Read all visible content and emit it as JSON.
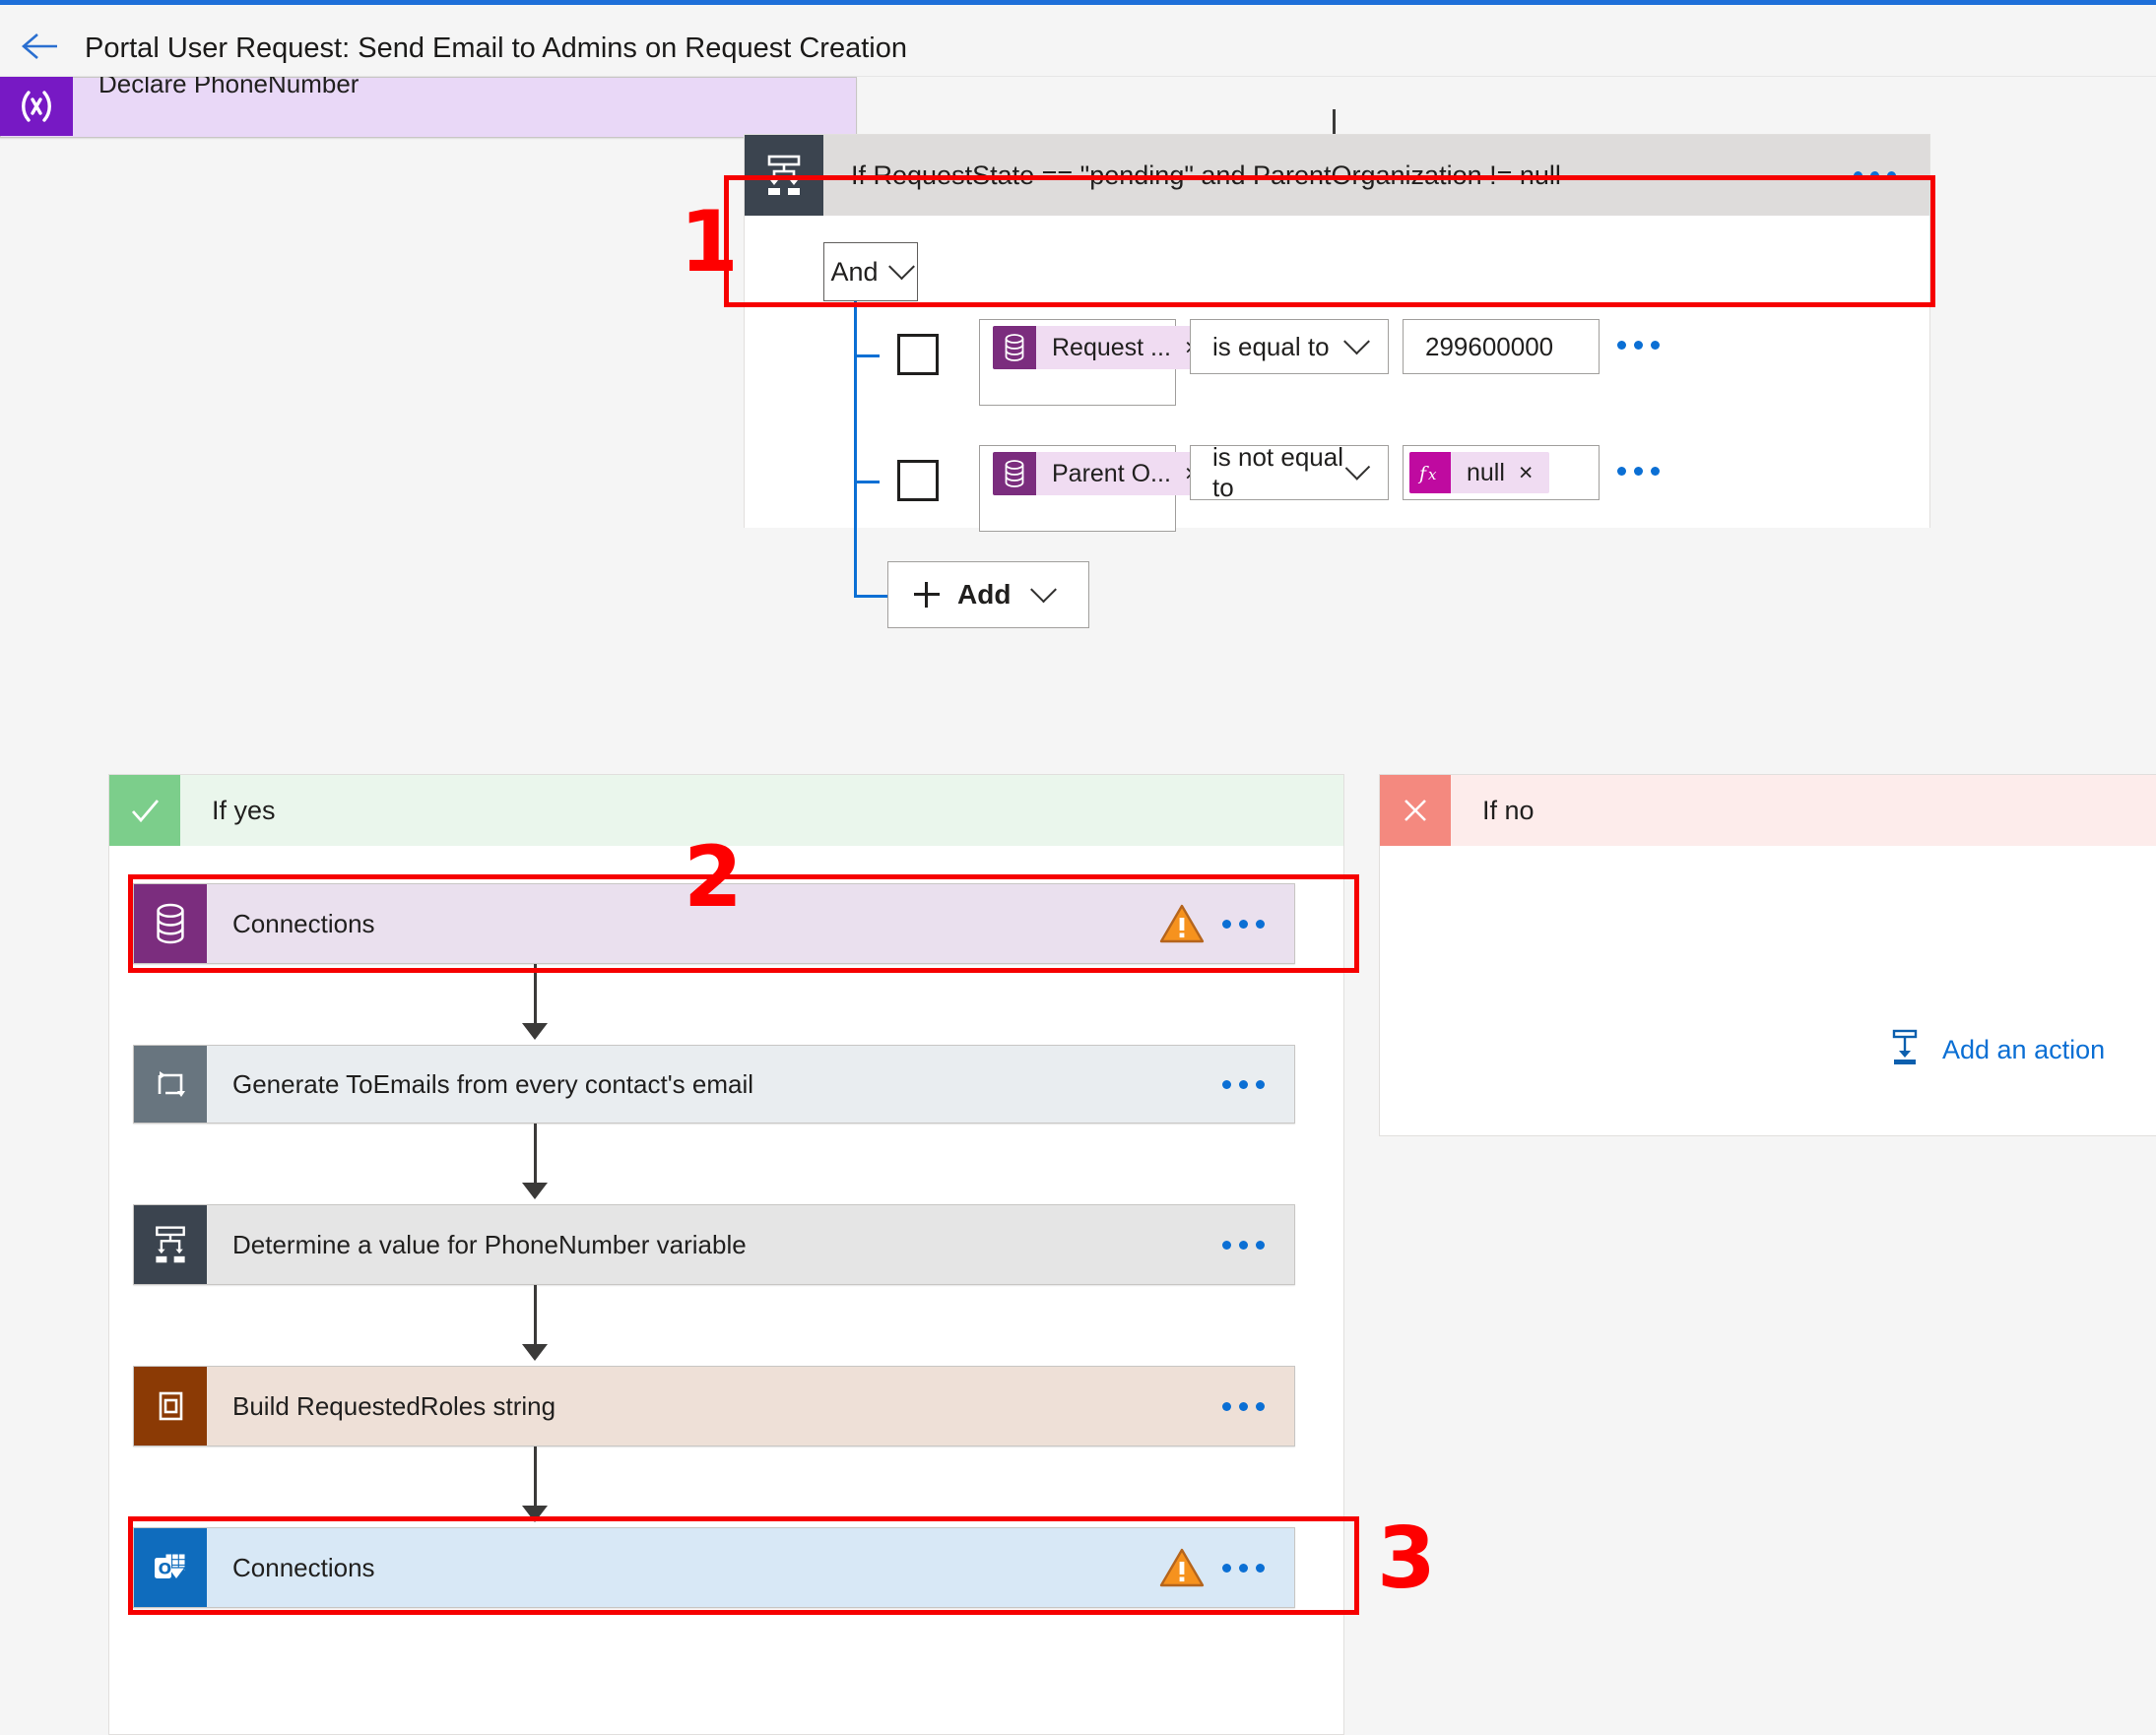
{
  "header": {
    "back_icon": "back-arrow-icon",
    "title": "Portal User Request: Send Email to Admins on Request Creation"
  },
  "flow": {
    "preceding_action": {
      "label": "Declare PhoneNumber",
      "icon": "variables-icon",
      "icon_color": "#7719c4",
      "body_color": "#e9d8f7"
    },
    "condition": {
      "title": "If RequestState == \"pending\" and ParentOrganization != null",
      "icon": "condition-icon",
      "icon_color": "#3b444f",
      "header_color": "#dedcdb",
      "more_label": "•••",
      "operator": "And",
      "rows": [
        {
          "token_label": "Request ...",
          "token_icon": "dataverse-icon",
          "token_remove": "×",
          "operator": "is equal to",
          "value_type": "text",
          "value": "299600000",
          "more_label": "•••"
        },
        {
          "token_label": "Parent O...",
          "token_icon": "dataverse-icon",
          "token_remove": "×",
          "operator": "is not equal to",
          "value_type": "expression",
          "value_icon": "fx-icon",
          "value": "null",
          "value_remove": "×",
          "more_label": "•••"
        }
      ],
      "add_label": "Add"
    },
    "yes_branch": {
      "label": "If yes",
      "icon": "checkmark-icon",
      "icon_color": "#7cce8b",
      "header_color": "#eaf6ec",
      "actions": [
        {
          "label": "Connections",
          "icon": "dataverse-icon",
          "icon_color": "#7b2d7e",
          "body_color": "#eae0ee",
          "warning": true,
          "warning_icon": "warning-icon",
          "more_label": "•••"
        },
        {
          "label": "Generate ToEmails from every contact's email",
          "icon": "apply-to-each-icon",
          "icon_color": "#68757f",
          "body_color": "#e9edf0",
          "warning": false,
          "more_label": "•••"
        },
        {
          "label": "Determine a value for PhoneNumber variable",
          "icon": "condition-icon",
          "icon_color": "#3b444f",
          "body_color": "#e5e5e5",
          "warning": false,
          "more_label": "•••"
        },
        {
          "label": "Build RequestedRoles string",
          "icon": "compose-icon",
          "icon_color": "#8b3a05",
          "body_color": "#eee0d7",
          "warning": false,
          "more_label": "•••"
        },
        {
          "label": "Connections",
          "icon": "outlook-icon",
          "icon_color": "#0f6cbd",
          "body_color": "#d8e8f6",
          "warning": true,
          "warning_icon": "warning-icon",
          "more_label": "•••"
        }
      ]
    },
    "no_branch": {
      "label": "If no",
      "icon": "close-x-icon",
      "icon_color": "#f4897f",
      "header_color": "#fdeceb",
      "add_action_label": "Add an action",
      "add_action_icon": "add-action-icon"
    }
  },
  "annotations": [
    {
      "number": "1"
    },
    {
      "number": "2"
    },
    {
      "number": "3"
    }
  ],
  "colors": {
    "accent": "#0b6fd4",
    "annotation_red": "#fe0000",
    "warning_orange": "#f6921e"
  }
}
